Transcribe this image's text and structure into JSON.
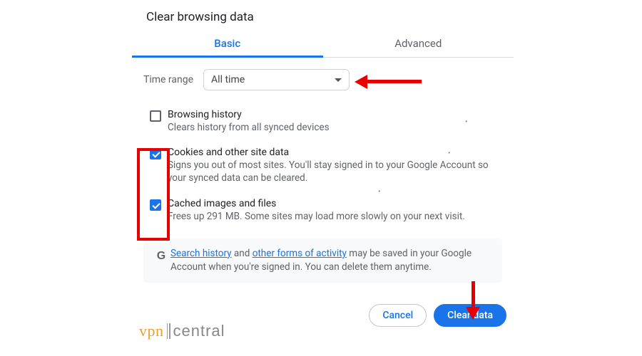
{
  "dialog": {
    "title": "Clear browsing data",
    "tabs": {
      "basic": "Basic",
      "advanced": "Advanced"
    },
    "time_range": {
      "label": "Time range",
      "value": "All time"
    },
    "options": {
      "history": {
        "title": "Browsing history",
        "desc": "Clears history from all synced devices",
        "checked": false
      },
      "cookies": {
        "title": "Cookies and other site data",
        "desc": "Signs you out of most sites. You'll stay signed in to your Google Account so your synced data can be cleared.",
        "checked": true
      },
      "cache": {
        "title": "Cached images and files",
        "desc": "Frees up 291 MB. Some sites may load more slowly on your next visit.",
        "checked": true
      }
    },
    "info": {
      "pre": "",
      "link1": "Search history",
      "mid1": " and ",
      "link2": "other forms of activity",
      "post": " may be saved in your Google Account when you're signed in. You can delete them anytime."
    },
    "buttons": {
      "cancel": "Cancel",
      "confirm": "Clear data"
    }
  },
  "watermark": {
    "left": "vpn",
    "right": "central"
  }
}
